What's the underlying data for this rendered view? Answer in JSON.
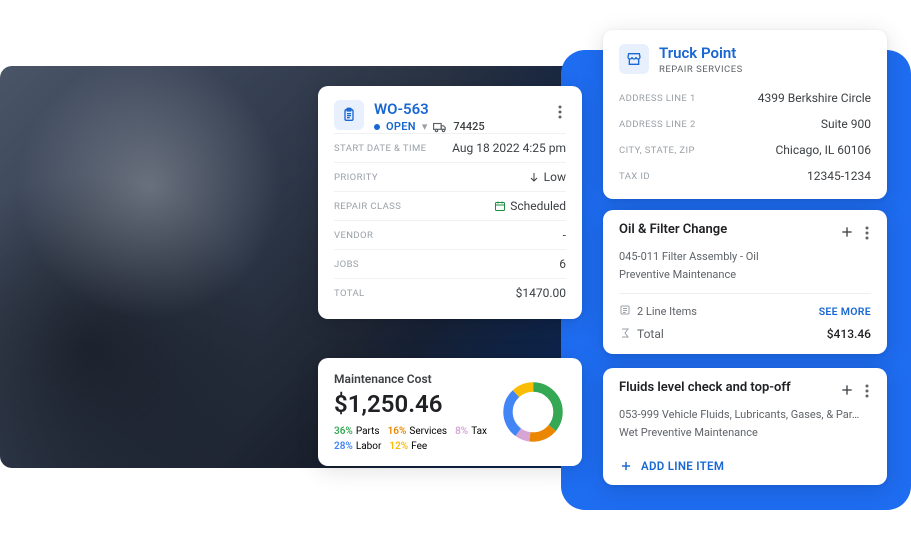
{
  "work_order": {
    "id": "WO-563",
    "status": "OPEN",
    "asset_number": "74425",
    "start_label": "START DATE & TIME",
    "start_value": "Aug 18 2022 4:25 pm",
    "priority_label": "PRIORITY",
    "priority_value": "Low",
    "repair_class_label": "REPAIR CLASS",
    "repair_class_value": "Scheduled",
    "vendor_label": "VENDOR",
    "vendor_value": "-",
    "jobs_label": "JOBS",
    "jobs_value": "6",
    "total_label": "TOTAL",
    "total_value": "$1470.00"
  },
  "maintenance_cost": {
    "title": "Maintenance Cost",
    "amount": "$1,250.46",
    "legend": {
      "parts_pct": "36%",
      "parts_lbl": "Parts",
      "services_pct": "16%",
      "services_lbl": "Services",
      "tax_pct": "8%",
      "tax_lbl": "Tax",
      "labor_pct": "28%",
      "labor_lbl": "Labor",
      "fee_pct": "12%",
      "fee_lbl": "Fee"
    },
    "colors": {
      "parts": "#34a853",
      "services": "#ea8600",
      "tax": "#d6a5d6",
      "labor": "#4285f4",
      "fee": "#fbbc04"
    }
  },
  "vendor": {
    "name": "Truck Point",
    "subtitle": "REPAIR SERVICES",
    "addr1_label": "ADDRESS LINE 1",
    "addr1_value": "4399 Berkshire Circle",
    "addr2_label": "ADDRESS LINE 2",
    "addr2_value": "Suite 900",
    "csz_label": "CITY, STATE, ZIP",
    "csz_value": "Chicago, IL 60106",
    "tax_label": "TAX ID",
    "tax_value": "12345-1234"
  },
  "task1": {
    "title": "Oil & Filter Change",
    "subtitle1": "045-011 Filter Assembly - Oil",
    "subtitle2": "Preventive Maintenance",
    "line_items_text": "2 Line Items",
    "see_more": "SEE MORE",
    "total_label": "Total",
    "total_value": "$413.46"
  },
  "task2": {
    "title": "Fluids level check and top-off",
    "subtitle1": "053-999 Vehicle Fluids, Lubricants, Gases, & Par…",
    "subtitle2": "Wet Preventive Maintenance",
    "add_line_item": "ADD LINE ITEM"
  },
  "chart_data": {
    "type": "pie",
    "title": "Maintenance Cost",
    "total": 1250.46,
    "series": [
      {
        "name": "Parts",
        "value": 36,
        "color": "#34a853"
      },
      {
        "name": "Services",
        "value": 16,
        "color": "#ea8600"
      },
      {
        "name": "Tax",
        "value": 8,
        "color": "#d6a5d6"
      },
      {
        "name": "Labor",
        "value": 28,
        "color": "#4285f4"
      },
      {
        "name": "Fee",
        "value": 12,
        "color": "#fbbc04"
      }
    ]
  }
}
